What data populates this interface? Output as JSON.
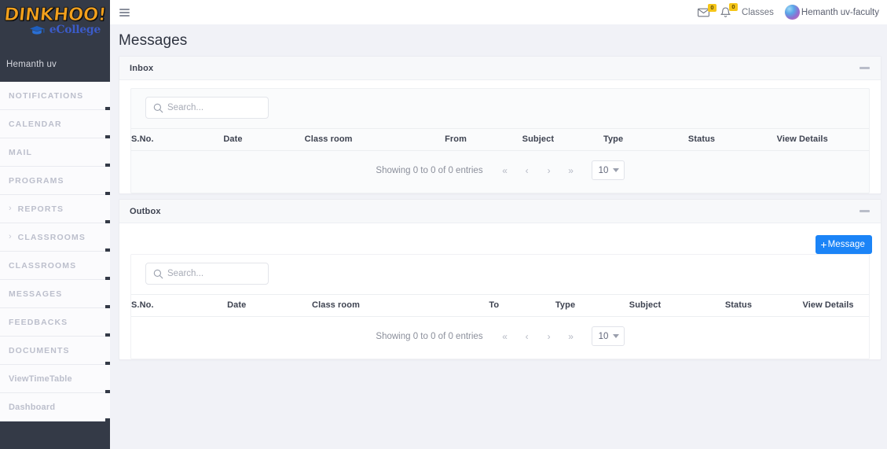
{
  "brand": {
    "logo_main": "DINKHOO!",
    "logo_sub": "eCollege",
    "user": "Hemanth uv"
  },
  "sidebar": {
    "items": [
      {
        "label": "NOTIFICATIONS",
        "chevron": false,
        "mixed": false
      },
      {
        "label": "CALENDAR",
        "chevron": false,
        "mixed": false
      },
      {
        "label": "MAIL",
        "chevron": false,
        "mixed": false
      },
      {
        "label": "PROGRAMS",
        "chevron": false,
        "mixed": false
      },
      {
        "label": "REPORTS",
        "chevron": true,
        "mixed": false
      },
      {
        "label": "CLASSROOMS",
        "chevron": true,
        "mixed": false
      },
      {
        "label": "CLASSROOMS",
        "chevron": false,
        "mixed": false
      },
      {
        "label": "MESSAGES",
        "chevron": false,
        "mixed": false
      },
      {
        "label": "FEEDBACKS",
        "chevron": false,
        "mixed": false
      },
      {
        "label": "DOCUMENTS",
        "chevron": false,
        "mixed": false
      },
      {
        "label": "ViewTimeTable",
        "chevron": false,
        "mixed": true
      },
      {
        "label": "Dashboard",
        "chevron": false,
        "mixed": true
      }
    ]
  },
  "topbar": {
    "menu_icon": "hamburger-icon",
    "mail_icon": "envelope-icon",
    "mail_badge": "0",
    "bell_icon": "bell-icon",
    "bell_badge": "0",
    "classes_link": "Classes",
    "user_name": "Hemanth uv-faculty",
    "avatar_icon": "avatar-icon"
  },
  "page": {
    "title": "Messages"
  },
  "inbox": {
    "title": "Inbox",
    "collapse_icon": "minus-icon",
    "search": {
      "value": "",
      "placeholder": "Search..."
    },
    "columns": [
      "S.No.",
      "Date",
      "Class room",
      "From",
      "Subject",
      "Type",
      "Status",
      "View Details"
    ],
    "pager": {
      "info": "Showing 0 to 0 of 0 entries",
      "first": "«",
      "prev": "‹",
      "next": "›",
      "last": "»",
      "page_size": "10"
    }
  },
  "outbox": {
    "title": "Outbox",
    "collapse_icon": "minus-icon",
    "new_message_button": "Message",
    "new_message_plus": "+",
    "search": {
      "value": "",
      "placeholder": "Search..."
    },
    "columns": [
      "S.No.",
      "Date",
      "Class room",
      "To",
      "Type",
      "Subject",
      "Status",
      "View Details"
    ],
    "pager": {
      "info": "Showing 0 to 0 of 0 entries",
      "first": "«",
      "prev": "‹",
      "next": "›",
      "last": "»",
      "page_size": "10"
    }
  },
  "colors": {
    "sidebar_bg": "#343a47",
    "accent_blue": "#1b84f7",
    "badge_yellow": "#f5c518",
    "page_bg": "#f1f2f7",
    "logo_orange": "#f4a11c",
    "logo_blue": "#3b5bc8"
  }
}
